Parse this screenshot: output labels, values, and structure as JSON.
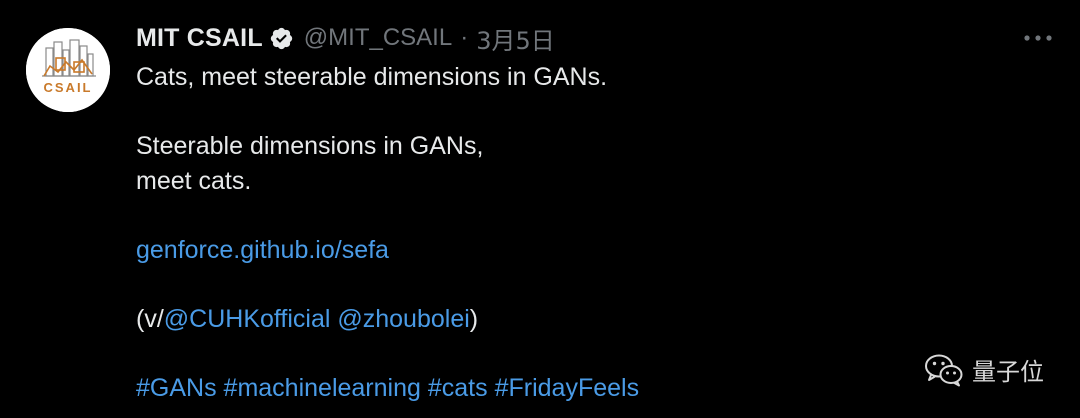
{
  "tweet": {
    "author_name": "MIT CSAIL",
    "handle": "@MIT_CSAIL",
    "separator": "·",
    "date": "3月5日",
    "avatar_label": "CSAIL",
    "more_icon": "more-dots-icon",
    "verified_icon": "verified-badge-icon",
    "lines": {
      "l1": "Cats, meet steerable dimensions in GANs.",
      "l2": "Steerable dimensions in GANs,",
      "l3": "meet cats.",
      "link": "genforce.github.io/sefa",
      "via_prefix": "(v/",
      "mention1": "@CUHKofficial",
      "mention2": "@zhoubolei",
      "via_suffix": ")",
      "hashtags": [
        "#GANs",
        "#machinelearning",
        "#cats",
        "#FridayFeels"
      ]
    }
  },
  "watermark": {
    "text": "量子位",
    "icon": "wechat-icon"
  },
  "colors": {
    "background": "#000000",
    "text": "#e7e9ea",
    "muted": "#71767b",
    "link": "#4a9be6",
    "avatar_accent": "#c97a2b"
  }
}
